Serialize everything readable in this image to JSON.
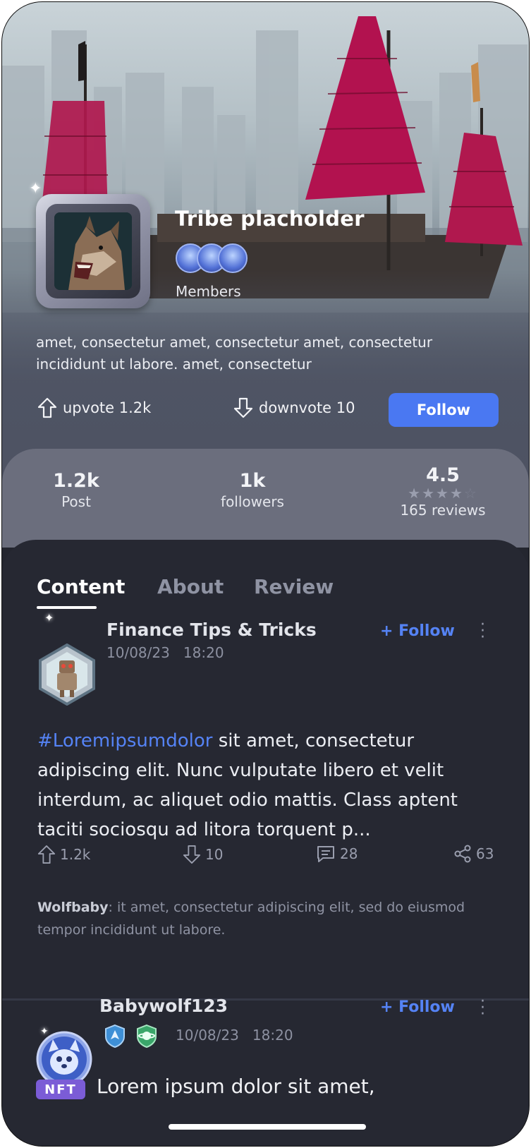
{
  "tribe": {
    "title": "Tribe placholder",
    "members_label": "Members",
    "description": "amet, consectetur  amet, consectetur  amet, consectetur incididunt ut labore. amet, consectetur",
    "upvote": "upvote 1.2k",
    "downvote": "downvote 10",
    "follow_label": "Follow"
  },
  "stats": {
    "posts": {
      "value": "1.2k",
      "label": "Post"
    },
    "followers": {
      "value": "1k",
      "label": "followers"
    },
    "rating": {
      "value": "4.5",
      "label": "165 reviews",
      "stars": 4.5
    }
  },
  "tabs": [
    {
      "label": "Content",
      "active": true
    },
    {
      "label": "About",
      "active": false
    },
    {
      "label": "Review",
      "active": false
    }
  ],
  "posts": [
    {
      "title": "Finance Tips & Tricks",
      "date": "10/08/23",
      "time": "18:20",
      "follow_label": "+ Follow",
      "hashtag": "#Loremipsumdolor",
      "body": " sit amet, consectetur adipiscing elit. Nunc vulputate libero et velit interdum, ac aliquet odio mattis. Class aptent taciti sociosqu ad litora torquent p...",
      "upvotes": "1.2k",
      "downvotes": "10",
      "comments": "28",
      "shares": "63",
      "comment_author": "Wolfbaby",
      "comment_text": ": it amet, consectetur adipiscing elit, sed do eiusmod tempor incididunt ut labore."
    },
    {
      "title": "Babywolf123",
      "date": "10/08/23",
      "time": "18:20",
      "follow_label": "+ Follow",
      "tag": "NFT",
      "body_start": "Lorem ipsum dolor sit amet,"
    }
  ],
  "colors": {
    "accent": "#4a78f2",
    "link": "#5583f5",
    "panel": "#262832",
    "stats_band": "#6b6e7d",
    "sail": "#b0184e",
    "nft": "#7b5cd6"
  }
}
